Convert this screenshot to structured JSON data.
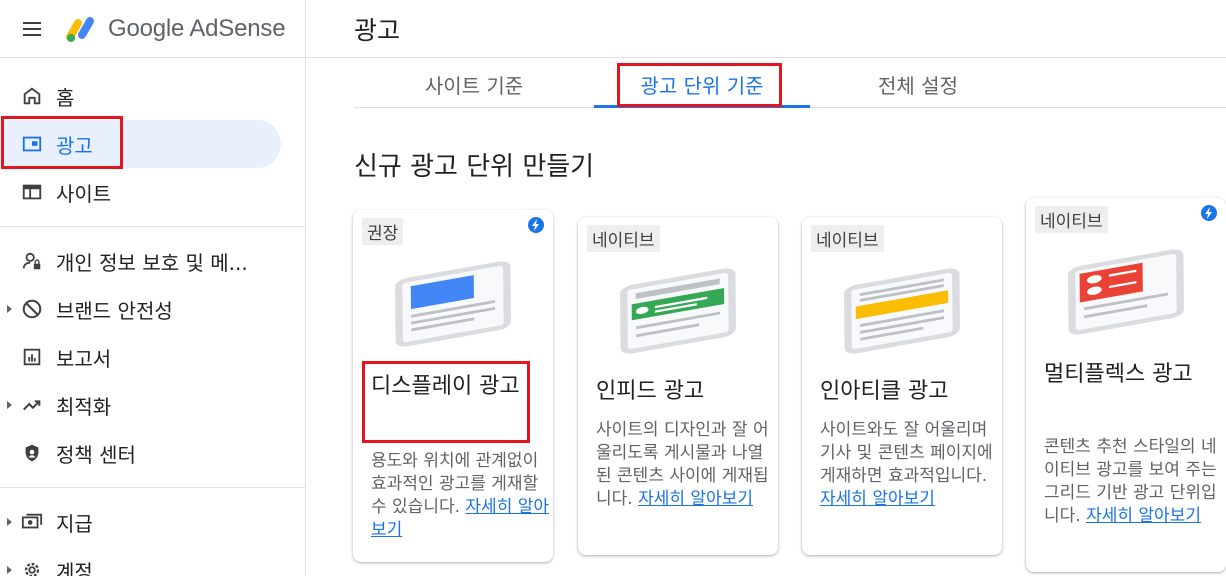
{
  "app": {
    "brand": "Google AdSense"
  },
  "header": {
    "title": "광고"
  },
  "sidebar": {
    "items": [
      {
        "label": "홈"
      },
      {
        "label": "광고"
      },
      {
        "label": "사이트"
      },
      {
        "label": "개인 정보 보호 및 메..."
      },
      {
        "label": "브랜드 안전성"
      },
      {
        "label": "보고서"
      },
      {
        "label": "최적화"
      },
      {
        "label": "정책 센터"
      },
      {
        "label": "지급"
      },
      {
        "label": "계정"
      }
    ]
  },
  "tabs": [
    {
      "label": "사이트 기준"
    },
    {
      "label": "광고 단위 기준"
    },
    {
      "label": "전체 설정"
    }
  ],
  "section": {
    "title": "신규 광고 단위 만들기"
  },
  "cards": [
    {
      "badge": "권장",
      "title": "디스플레이 광고",
      "description": "용도와 위치에 관계없이 효과적인 광고를 게재할 수 있습니다.",
      "link": "자세히 알아보기",
      "illus_color": "#4285f4"
    },
    {
      "badge": "네이티브",
      "title": "인피드 광고",
      "description": "사이트의 디자인과 잘 어울리도록 게시물과 나열된 콘텐츠 사이에 게재됩니다.",
      "link": "자세히 알아보기",
      "illus_color": "#34a853"
    },
    {
      "badge": "네이티브",
      "title": "인아티클 광고",
      "description": "사이트와도 잘 어울리며 기사 및 콘텐츠 페이지에 게재하면 효과적입니다.",
      "link": "자세히 알아보기",
      "illus_color": "#fbbc04"
    },
    {
      "badge": "네이티브",
      "title": "멀티플렉스 광고",
      "description": "콘텐츠 추천 스타일의 네이티브 광고를 보여 주는 그리드 기반 광고 단위입니다.",
      "link": "자세히 알아보기",
      "illus_color": "#ea4335"
    }
  ],
  "colors": {
    "accent": "#1a73e8",
    "highlight_box": "#e3151e",
    "active_nav_bg": "#e8f0fe"
  }
}
